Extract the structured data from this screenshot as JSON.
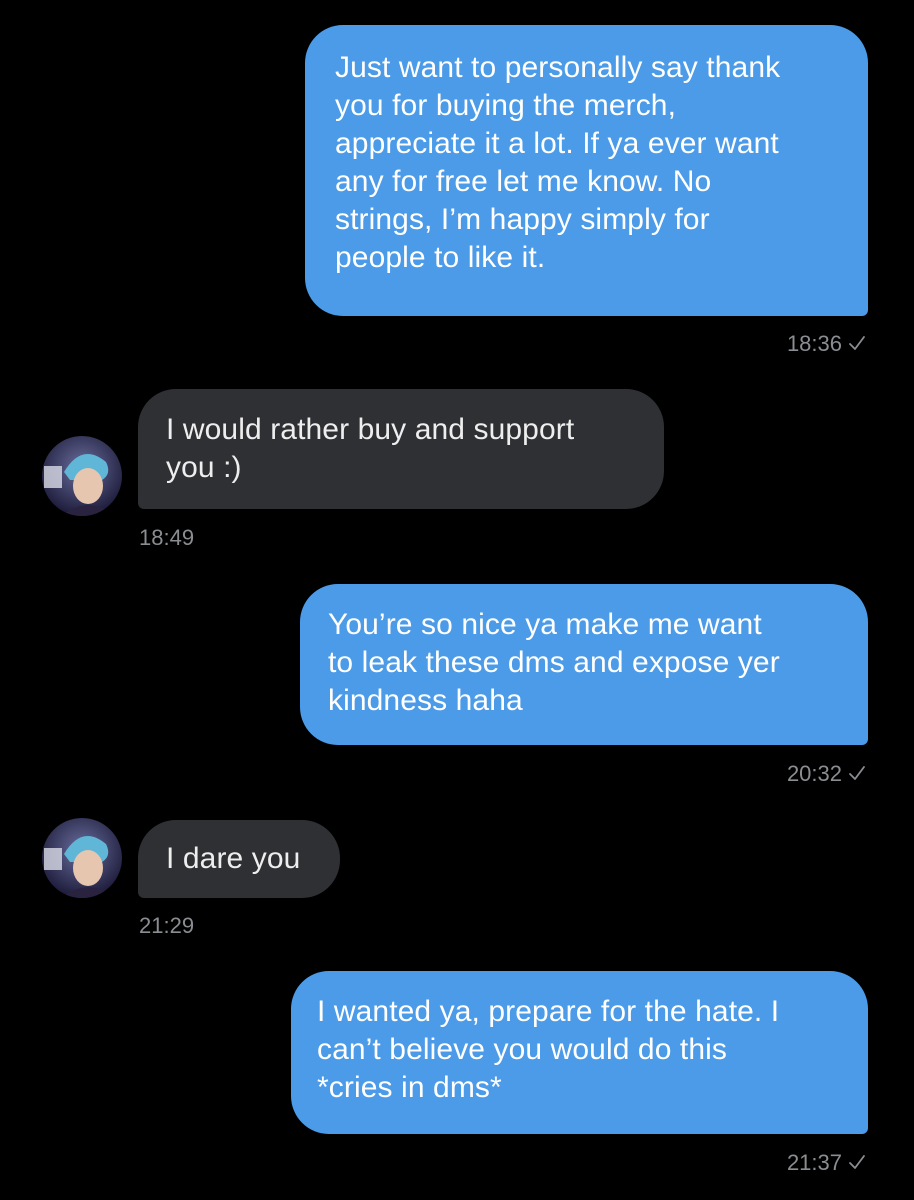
{
  "colors": {
    "background": "#000000",
    "sent_bubble": "#4c9be8",
    "received_bubble": "#2f3033",
    "timestamp": "#8a8d91"
  },
  "messages": [
    {
      "direction": "sent",
      "text": "Just want to personally say thank\nyou for buying the merch,\nappreciate it a lot. If ya ever want\nany for free let me know. No\nstrings, I’m happy simply for\npeople to like it.",
      "time": "18:36",
      "status_icon": "checkmark-icon"
    },
    {
      "direction": "received",
      "text": "I would rather buy and support\nyou :)",
      "time": "18:49",
      "avatar_icon": "avatar-icon"
    },
    {
      "direction": "sent",
      "text": "You’re so nice ya make me want\nto leak these dms and expose yer\nkindness haha",
      "time": "20:32",
      "status_icon": "checkmark-icon"
    },
    {
      "direction": "received",
      "text": "I dare you",
      "time": "21:29",
      "avatar_icon": "avatar-icon"
    },
    {
      "direction": "sent",
      "text": "I wanted ya, prepare for the hate. I\ncan’t believe you would do this\n*cries in dms*",
      "time": "21:37",
      "status_icon": "checkmark-icon"
    }
  ]
}
